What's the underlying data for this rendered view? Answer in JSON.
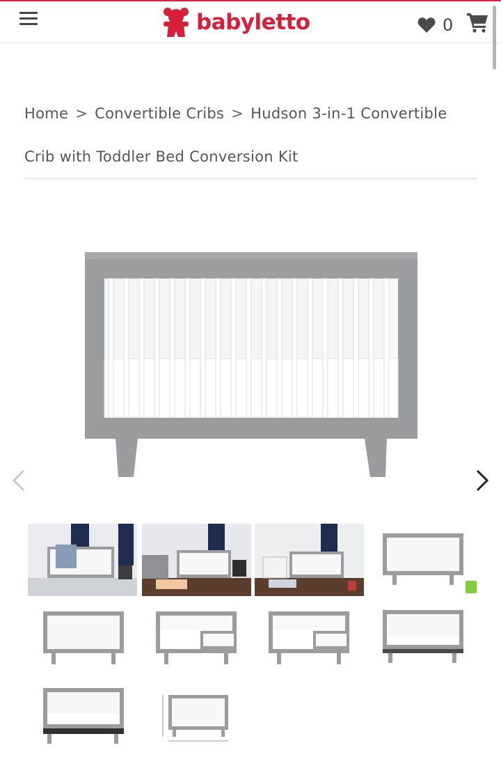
{
  "header": {
    "menu_icon": "hamburger-icon",
    "brand": "babyletto",
    "wishlist_icon": "heart-icon",
    "wishlist_count": "0",
    "cart_icon": "cart-icon",
    "brand_color": "#d81f3a"
  },
  "breadcrumb": {
    "separator": ">",
    "items": [
      {
        "label": "Home"
      },
      {
        "label": "Convertible Cribs"
      },
      {
        "label": "Hudson 3-in-1 Convertible Crib with Toddler Bed Conversion Kit"
      }
    ]
  },
  "gallery": {
    "prev_icon": "chevron-left-icon",
    "next_icon": "chevron-right-icon",
    "crib_color": "#9a9c9e",
    "thumbnails": [
      {
        "kind": "room-scene"
      },
      {
        "kind": "room-scene"
      },
      {
        "kind": "room-scene"
      },
      {
        "kind": "crib",
        "badge": "eco-badge"
      },
      {
        "kind": "crib"
      },
      {
        "kind": "toddler-bed"
      },
      {
        "kind": "toddler-bed"
      },
      {
        "kind": "daybed"
      },
      {
        "kind": "daybed"
      },
      {
        "kind": "dimensions"
      }
    ]
  }
}
